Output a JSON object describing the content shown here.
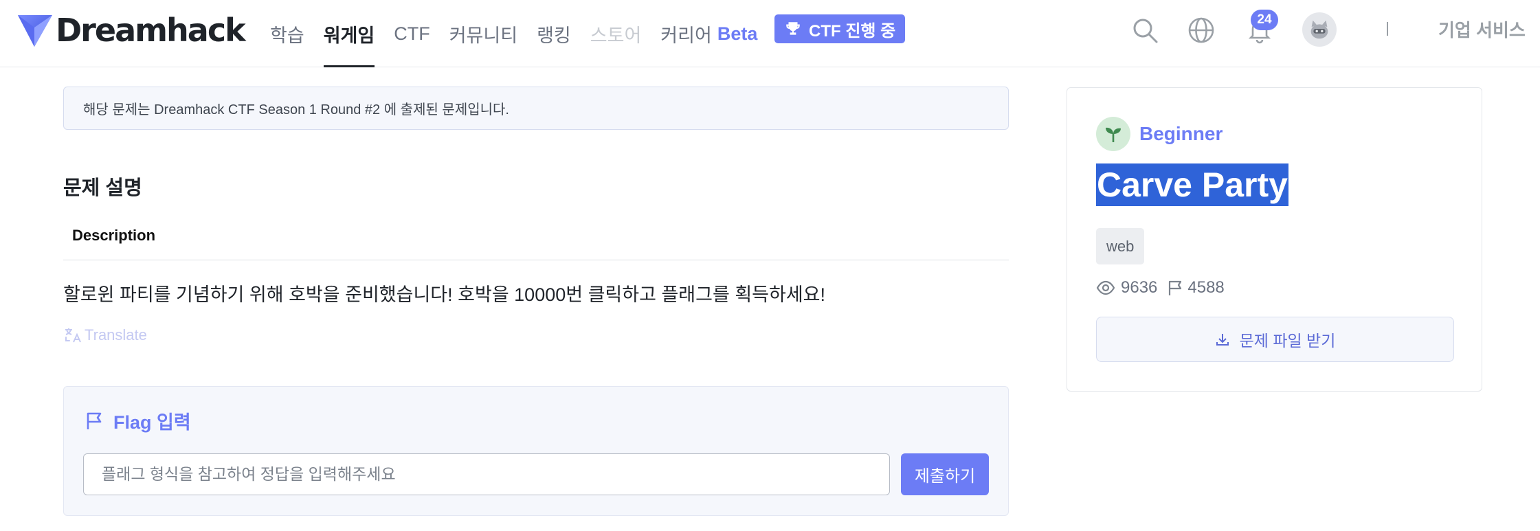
{
  "header": {
    "logo_text": "Dreamhack",
    "nav": [
      {
        "label": "학습",
        "state": "normal"
      },
      {
        "label": "워게임",
        "state": "active"
      },
      {
        "label": "CTF",
        "state": "normal"
      },
      {
        "label": "커뮤니티",
        "state": "normal"
      },
      {
        "label": "랭킹",
        "state": "normal"
      },
      {
        "label": "스토어",
        "state": "disabled"
      }
    ],
    "career_label": "커리어",
    "career_beta": "Beta",
    "ctf_badge": "CTF 진행 중",
    "notification_count": "24",
    "separator": "|",
    "business_link": "기업 서비스"
  },
  "notice": "해당 문제는 Dreamhack CTF Season 1 Round #2 에 출제된 문제입니다.",
  "description": {
    "section_title": "문제 설명",
    "heading": "Description",
    "text": "할로윈 파티를 기념하기 위해 호박을 준비했습니다! 호박을 10000번 클릭하고 플래그를 획득하세요!",
    "translate_label": "Translate"
  },
  "flag": {
    "title": "Flag 입력",
    "input_value": "",
    "placeholder": "플래그 형식을 참고하여 정답을 입력해주세요",
    "submit_label": "제출하기"
  },
  "challenge": {
    "level": "Beginner",
    "title": "Carve Party",
    "tag": "web",
    "views": "9636",
    "solves": "4588",
    "download_label": "문제 파일 받기"
  },
  "colors": {
    "accent": "#6c7cf5",
    "title_highlight": "#2f63d8",
    "level_icon_bg": "#d4ecd8"
  },
  "icons": [
    "dreamhack-logo-icon",
    "trophy-icon",
    "search-icon",
    "globe-icon",
    "bell-icon",
    "avatar-icon",
    "translate-icon",
    "flag-icon",
    "sprout-icon",
    "eye-icon",
    "download-icon"
  ]
}
